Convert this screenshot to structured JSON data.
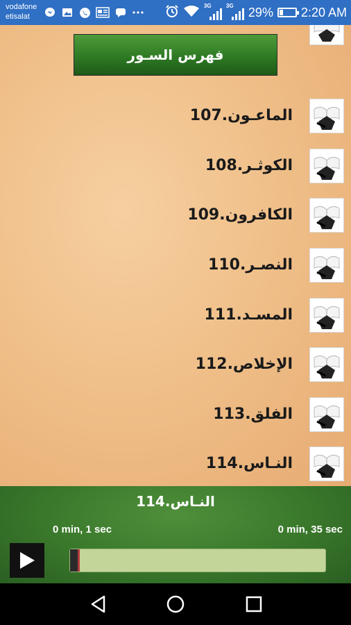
{
  "status_bar": {
    "carrier_1": "vodafone",
    "carrier_2": "etisalat",
    "network_1": "3G",
    "network_2": "3G",
    "battery": "29%",
    "battery_level": 0.29,
    "time": "2:20 AM",
    "notification_icons": [
      "messenger-icon",
      "gallery-icon",
      "whatsapp-icon",
      "news-icon",
      "message-icon",
      "more-icon"
    ],
    "bg_color": "#2f6fc4"
  },
  "header": {
    "title": "فهرس السـور"
  },
  "surah_list": [
    {
      "label": "107.الماعـون"
    },
    {
      "label": "108.الكوثـر"
    },
    {
      "label": "109.الكافرون"
    },
    {
      "label": "110.النصـر"
    },
    {
      "label": "111.المسـد"
    },
    {
      "label": "112.الإخلاص"
    },
    {
      "label": "113.الفلق"
    },
    {
      "label": "114.النـاس"
    }
  ],
  "player": {
    "now_playing": "114.النـاس",
    "elapsed": "0 min, 1 sec",
    "duration": "0 min, 35 sec",
    "progress": 0.03
  },
  "nav_bar": {
    "icons": [
      "back-icon",
      "home-icon",
      "recents-icon"
    ]
  }
}
